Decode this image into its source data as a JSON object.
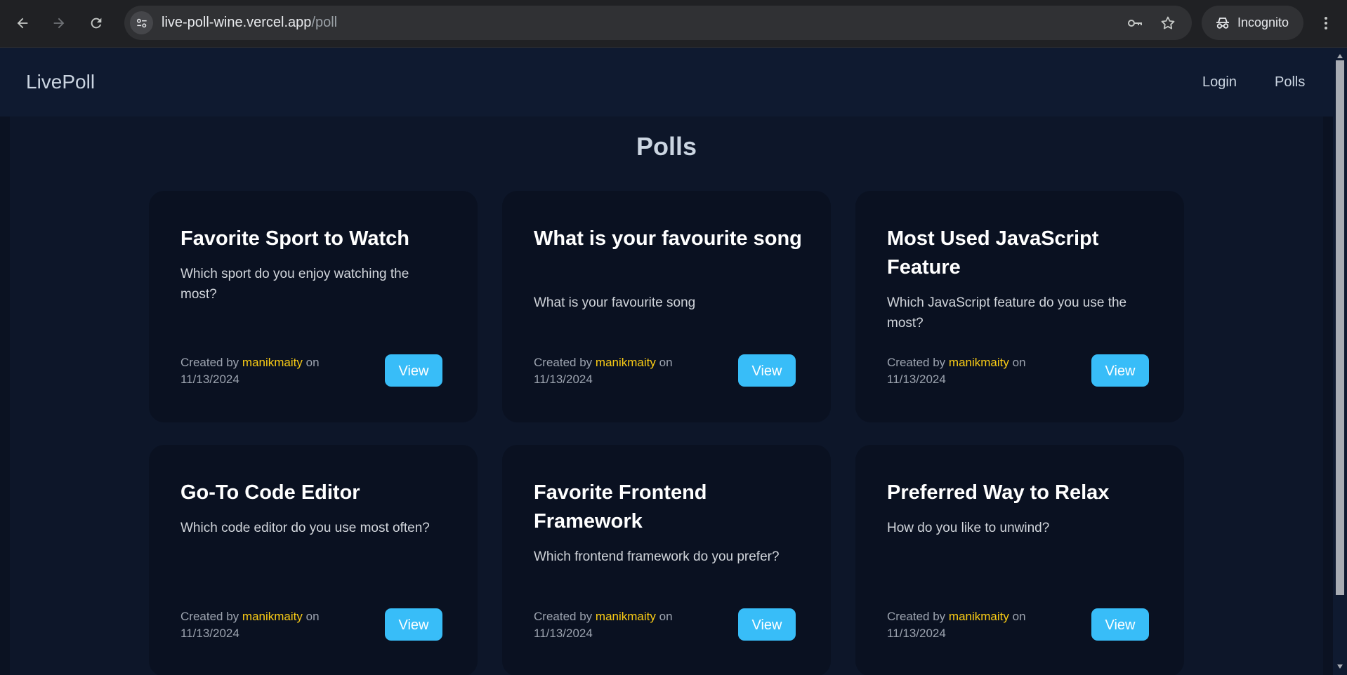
{
  "browser": {
    "url_host": "live-poll-wine.vercel.app",
    "url_path": "/poll",
    "incognito_label": "Incognito"
  },
  "site": {
    "brand": "LivePoll",
    "nav": [
      {
        "label": "Login"
      },
      {
        "label": "Polls"
      }
    ]
  },
  "main": {
    "title": "Polls",
    "cards": [
      {
        "title": "Favorite Sport to Watch",
        "description": "Which sport do you enjoy watching the most?",
        "created_prefix": "Created by",
        "author": "manikmaity",
        "created_on": "on",
        "date": "11/13/2024",
        "button": "View"
      },
      {
        "title": "What is your favourite song",
        "description": "What is your favourite song",
        "created_prefix": "Created by",
        "author": "manikmaity",
        "created_on": "on",
        "date": "11/13/2024",
        "button": "View"
      },
      {
        "title": "Most Used JavaScript Feature",
        "description": "Which JavaScript feature do you use the most?",
        "created_prefix": "Created by",
        "author": "manikmaity",
        "created_on": "on",
        "date": "11/13/2024",
        "button": "View"
      },
      {
        "title": "Go-To Code Editor",
        "description": "Which code editor do you use most often?",
        "created_prefix": "Created by",
        "author": "manikmaity",
        "created_on": "on",
        "date": "11/13/2024",
        "button": "View"
      },
      {
        "title": "Favorite Frontend Framework",
        "description": "Which frontend framework do you prefer?",
        "created_prefix": "Created by",
        "author": "manikmaity",
        "created_on": "on",
        "date": "11/13/2024",
        "button": "View"
      },
      {
        "title": "Preferred Way to Relax",
        "description": "How do you like to unwind?",
        "created_prefix": "Created by",
        "author": "manikmaity",
        "created_on": "on",
        "date": "11/13/2024",
        "button": "View"
      }
    ]
  },
  "icons": {
    "back": "arrow-left-icon",
    "forward": "arrow-right-icon",
    "reload": "reload-icon",
    "site_info": "tune-icon",
    "password": "key-icon",
    "bookmark": "star-icon",
    "incognito": "incognito-icon",
    "menu": "kebab-menu-icon"
  },
  "colors": {
    "page_bg": "#0b1222",
    "header_bg": "#0f1a30",
    "card_bg": "#0a1121",
    "accent_button": "#38bdf8",
    "author_highlight": "#facc15"
  }
}
